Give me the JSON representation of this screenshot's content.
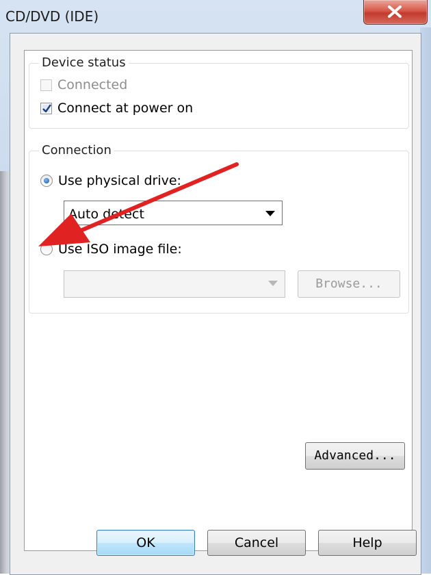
{
  "window": {
    "title": "CD/DVD (IDE)"
  },
  "device_status": {
    "legend": "Device status",
    "connected_label": "Connected",
    "connected_checked": false,
    "connected_enabled": false,
    "connect_power_on_label": "Connect at power on",
    "connect_power_on_checked": true
  },
  "connection": {
    "legend": "Connection",
    "physical_label": "Use physical drive:",
    "physical_selected": true,
    "drive_select_value": "Auto detect",
    "iso_label": "Use ISO image file:",
    "iso_selected": false,
    "iso_path_value": "",
    "browse_label": "Browse..."
  },
  "buttons": {
    "advanced": "Advanced...",
    "ok": "OK",
    "cancel": "Cancel",
    "help": "Help"
  },
  "annotation": {
    "arrow_color": "#e02222"
  },
  "icons": {
    "close": "close-icon",
    "check": "checkmark-icon",
    "dropdown": "chevron-down-icon"
  }
}
